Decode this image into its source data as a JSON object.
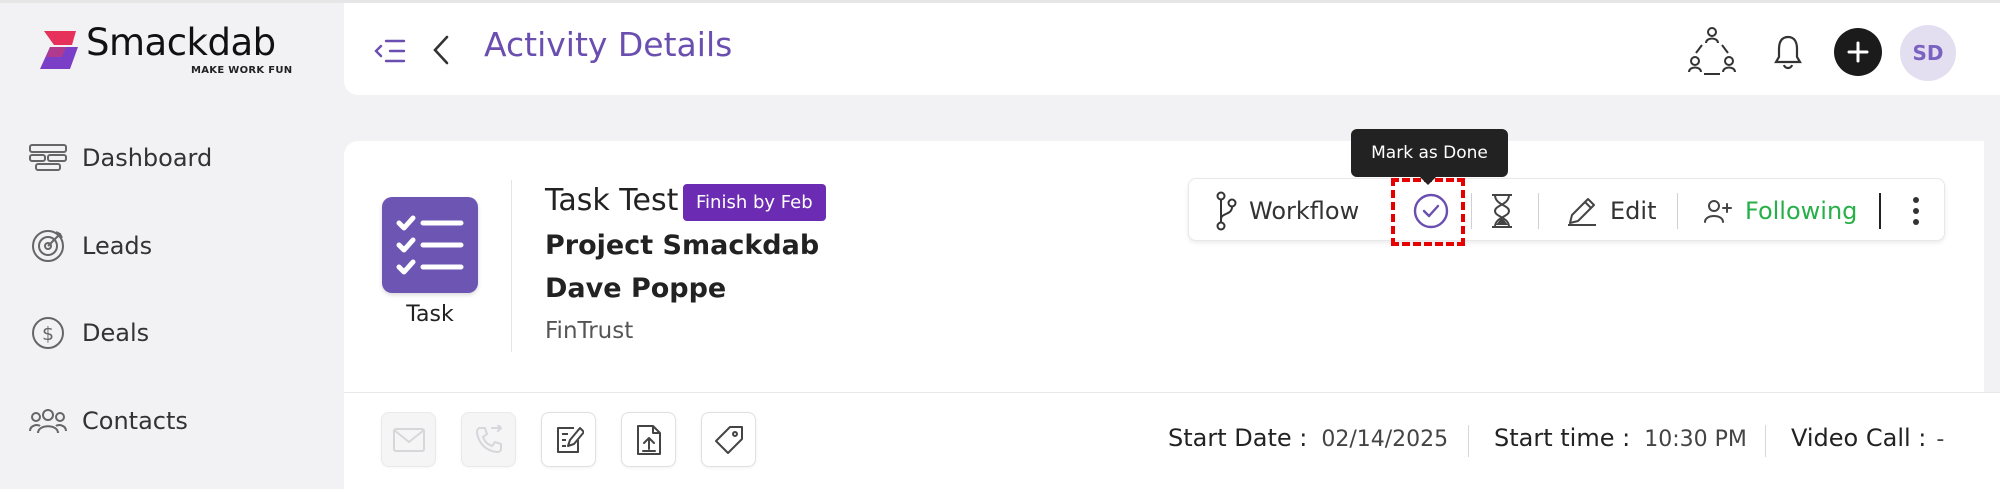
{
  "brand": {
    "name_bold": "Smack",
    "name_light": "dab",
    "tagline": "MAKE WORK FUN"
  },
  "sidebar": {
    "items": [
      {
        "label": "Dashboard",
        "icon": "dashboard-icon"
      },
      {
        "label": "Leads",
        "icon": "target-icon"
      },
      {
        "label": "Deals",
        "icon": "dollar-icon"
      },
      {
        "label": "Contacts",
        "icon": "contacts-icon"
      }
    ]
  },
  "header": {
    "title": "Activity Details",
    "avatar_initials": "SD"
  },
  "activity": {
    "type_label": "Task",
    "title": "Task Test",
    "badge": "Finish by Feb",
    "project": "Project Smackdab",
    "person": "Dave Poppe",
    "company": "FinTrust"
  },
  "toolbar": {
    "workflow_label": "Workflow",
    "edit_label": "Edit",
    "following_label": "Following",
    "tooltip": "Mark as Done"
  },
  "details": {
    "start_date_label": "Start Date :",
    "start_date_value": "02/14/2025",
    "start_time_label": "Start time :",
    "start_time_value": "10:30 PM",
    "video_call_label": "Video Call :",
    "video_call_value": "-"
  },
  "colors": {
    "brand_purple": "#6b4fb0",
    "badge_purple": "#6b2bb2",
    "following_green": "#27b04a",
    "highlight_red": "#e60000"
  }
}
